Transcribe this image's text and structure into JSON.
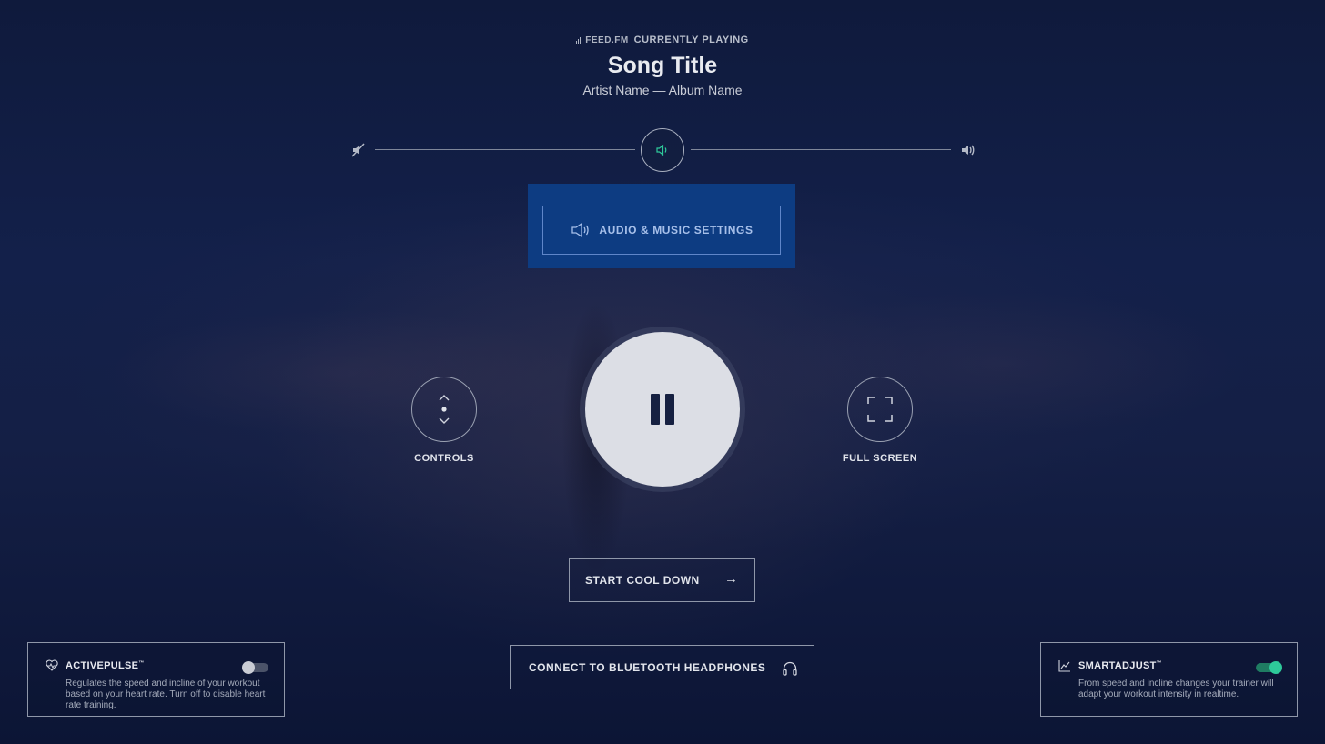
{
  "now_playing": {
    "brand": "FEED.FM",
    "header": "CURRENTLY PLAYING",
    "song_title": "Song Title",
    "subtitle": "Artist Name — Album Name"
  },
  "volume": {
    "level": 0.5
  },
  "audio_settings": {
    "label": "AUDIO & MUSIC SETTINGS"
  },
  "playback": {
    "state": "playing",
    "controls_label": "CONTROLS",
    "fullscreen_label": "FULL SCREEN"
  },
  "cool_down": {
    "label": "START COOL DOWN",
    "arrow": "→"
  },
  "bluetooth": {
    "label": "CONNECT TO BLUETOOTH HEADPHONES"
  },
  "activepulse": {
    "title": "ACTIVEPULSE",
    "tm": "™",
    "description": "Regulates the speed and incline of your workout based on your heart rate. Turn off to disable heart rate training.",
    "enabled": false
  },
  "smartadjust": {
    "title": "SMARTADJUST",
    "tm": "™",
    "description": "From speed and incline changes your trainer will adapt your workout intensity in realtime.",
    "enabled": true
  },
  "colors": {
    "accent_green": "#2ec99a",
    "audio_panel": "#0d3c82"
  }
}
